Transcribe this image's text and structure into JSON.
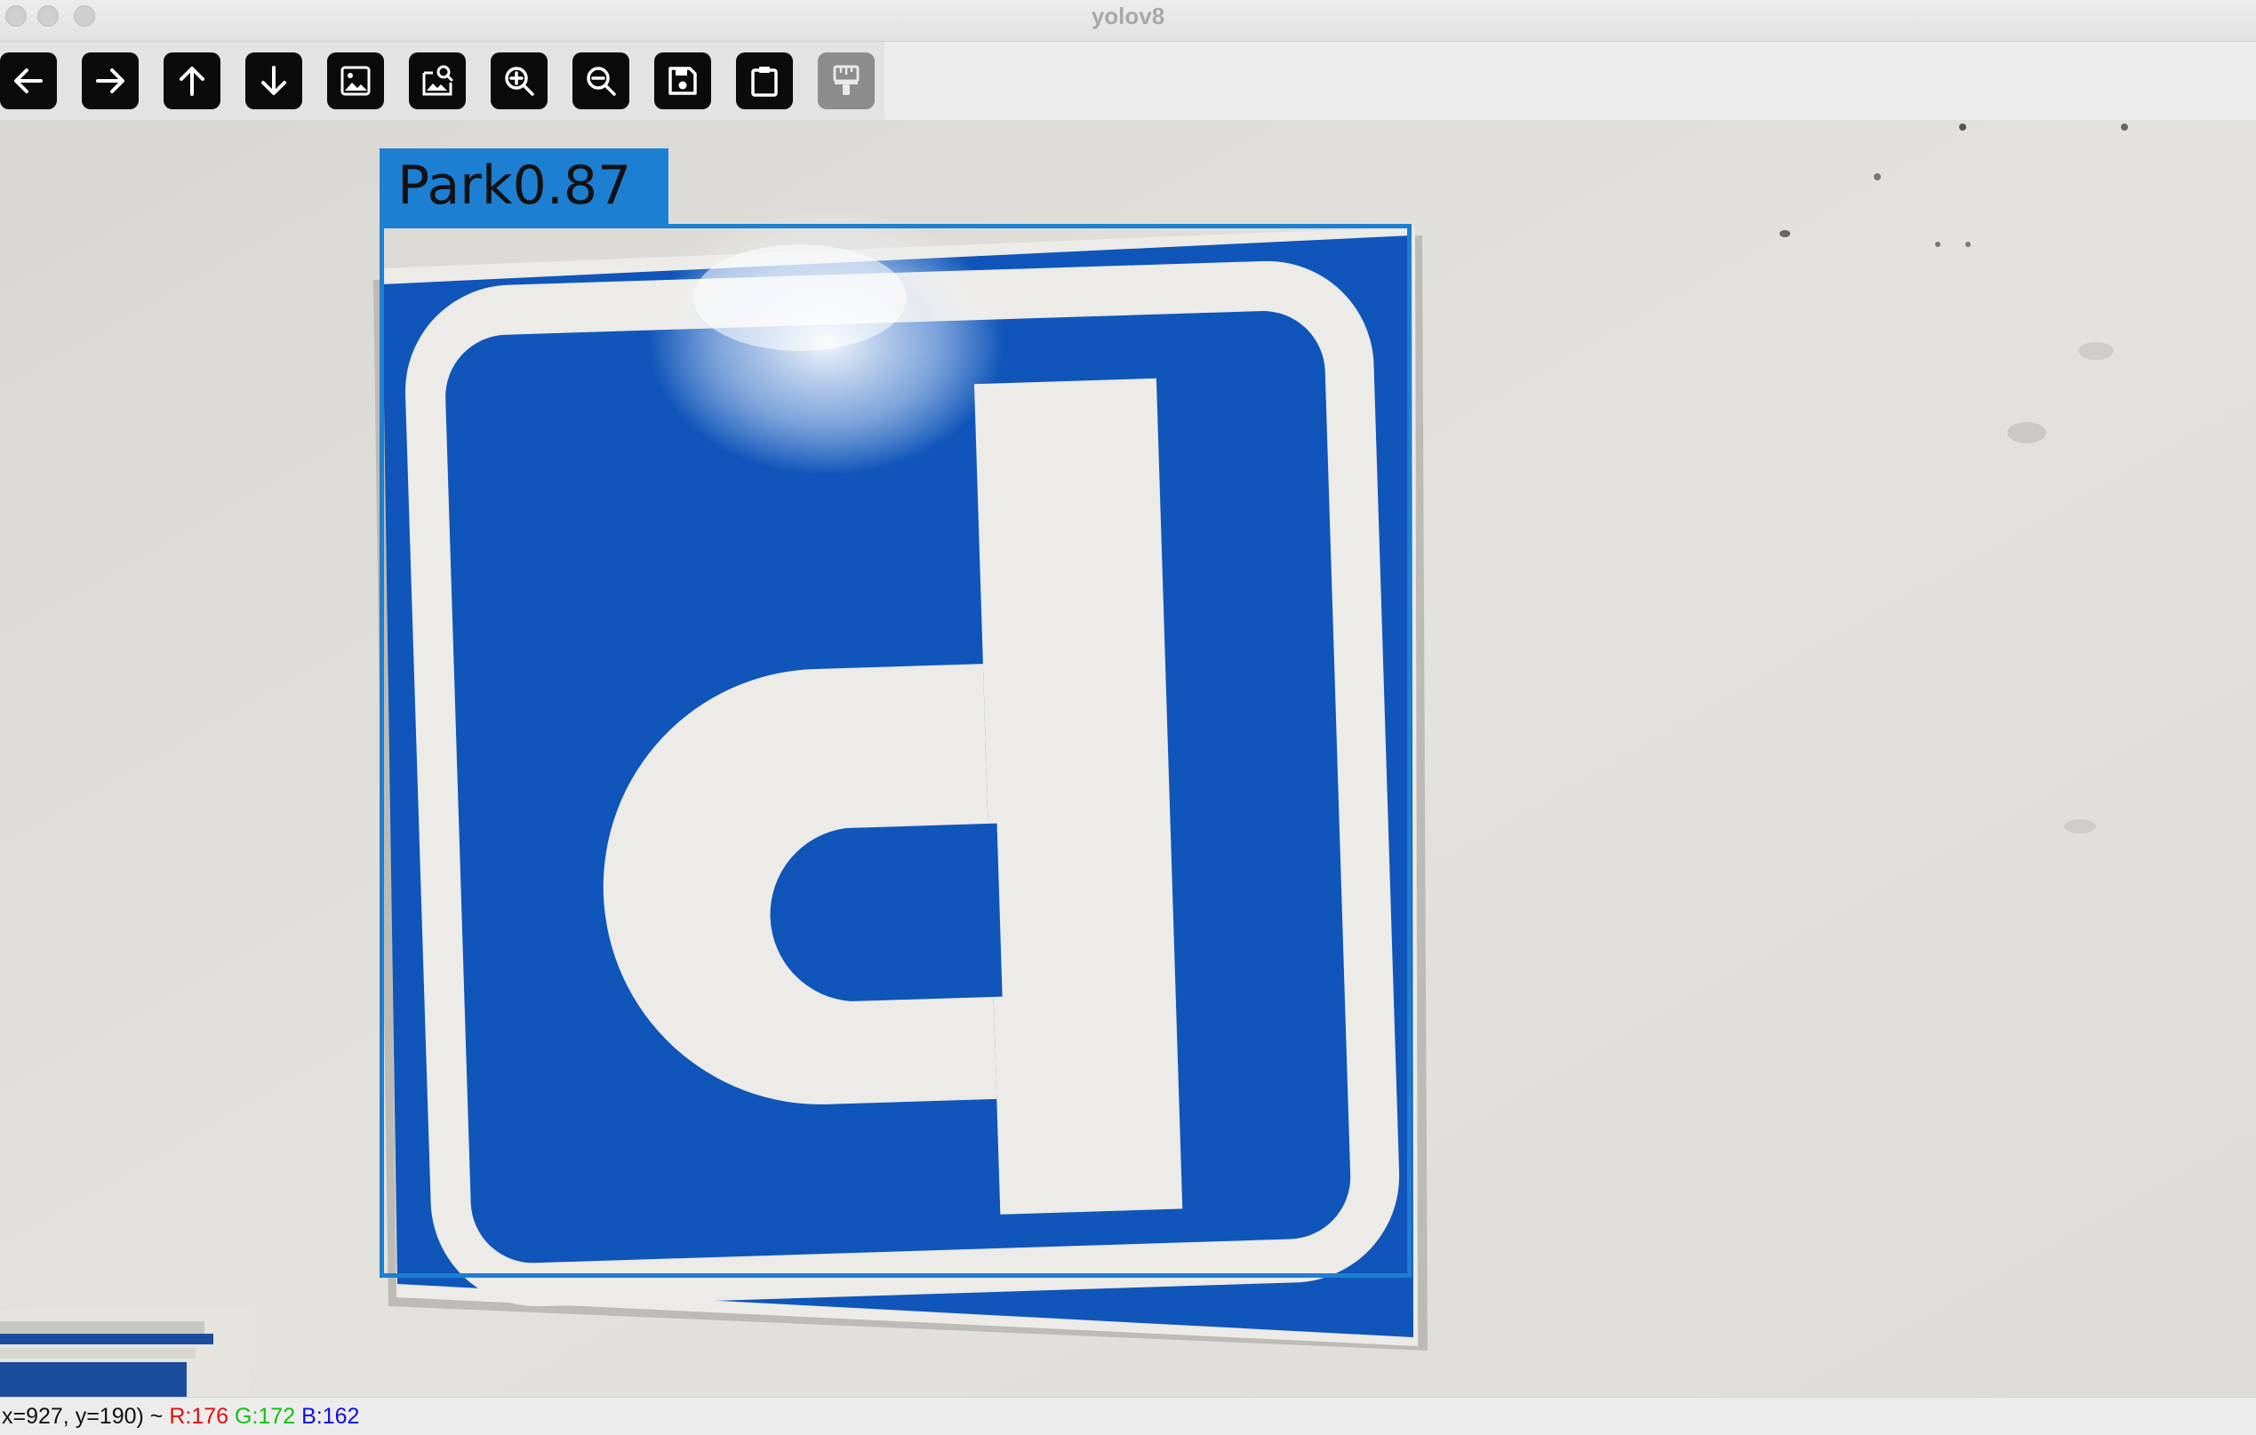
{
  "window": {
    "title": "yolov8",
    "controls": [
      "close",
      "minimize",
      "zoom"
    ]
  },
  "toolbar": {
    "buttons": [
      {
        "name": "back",
        "icon": "arrow-left-icon",
        "enabled": true
      },
      {
        "name": "forward",
        "icon": "arrow-right-icon",
        "enabled": true
      },
      {
        "name": "up",
        "icon": "arrow-up-icon",
        "enabled": true
      },
      {
        "name": "down",
        "icon": "arrow-down-icon",
        "enabled": true
      },
      {
        "name": "zoom-to-fit",
        "icon": "image-icon",
        "enabled": true
      },
      {
        "name": "zoom-to-original",
        "icon": "image-search-icon",
        "enabled": true
      },
      {
        "name": "zoom-in",
        "icon": "zoom-in-icon",
        "enabled": true
      },
      {
        "name": "zoom-out",
        "icon": "zoom-out-icon",
        "enabled": true
      },
      {
        "name": "save",
        "icon": "save-icon",
        "enabled": true
      },
      {
        "name": "copy-to-clipboard",
        "icon": "clipboard-icon",
        "enabled": true
      },
      {
        "name": "properties",
        "icon": "paint-brush-icon",
        "enabled": false
      }
    ]
  },
  "image": {
    "description": "Parking sign photo with YOLOv8 detection",
    "detection": {
      "label": "Park0.87",
      "color": "#1d7fd2"
    }
  },
  "statusbar": {
    "coords": "x=927, y=190) ~",
    "r": "R:176",
    "g": "G:172",
    "b": "B:162"
  }
}
